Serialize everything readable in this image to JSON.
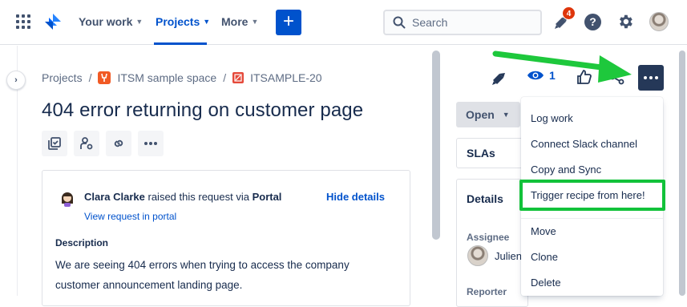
{
  "topnav": {
    "your_work": "Your work",
    "projects": "Projects",
    "more": "More",
    "create": "+",
    "search_placeholder": "Search",
    "notification_count": "4",
    "help": "?"
  },
  "breadcrumb": {
    "projects": "Projects",
    "sep1": "/",
    "space": "ITSM sample space",
    "sep2": "/",
    "issue_key": "ITSAMPLE-20"
  },
  "issue": {
    "title": "404 error returning on customer page"
  },
  "request": {
    "requester": "Clara Clarke",
    "raised_text": " raised this request via ",
    "channel": "Portal",
    "view_portal": "View request in portal",
    "hide_details": "Hide details",
    "description_label": "Description",
    "description": "We are seeing 404 errors when trying to access the company customer announcement landing page."
  },
  "side": {
    "watch_count": "1",
    "status": "Open",
    "slas": "SLAs",
    "details": "Details",
    "assignee_label": "Assignee",
    "assignee_name": "Julien",
    "reporter_label": "Reporter"
  },
  "menu": {
    "items": [
      "Log work",
      "Connect Slack channel",
      "Copy and Sync",
      "Trigger recipe from here!",
      "Move",
      "Clone",
      "Delete"
    ]
  },
  "colors": {
    "brand": "#0052cc",
    "highlight": "#12c23a",
    "arrow": "#1ec83c"
  }
}
